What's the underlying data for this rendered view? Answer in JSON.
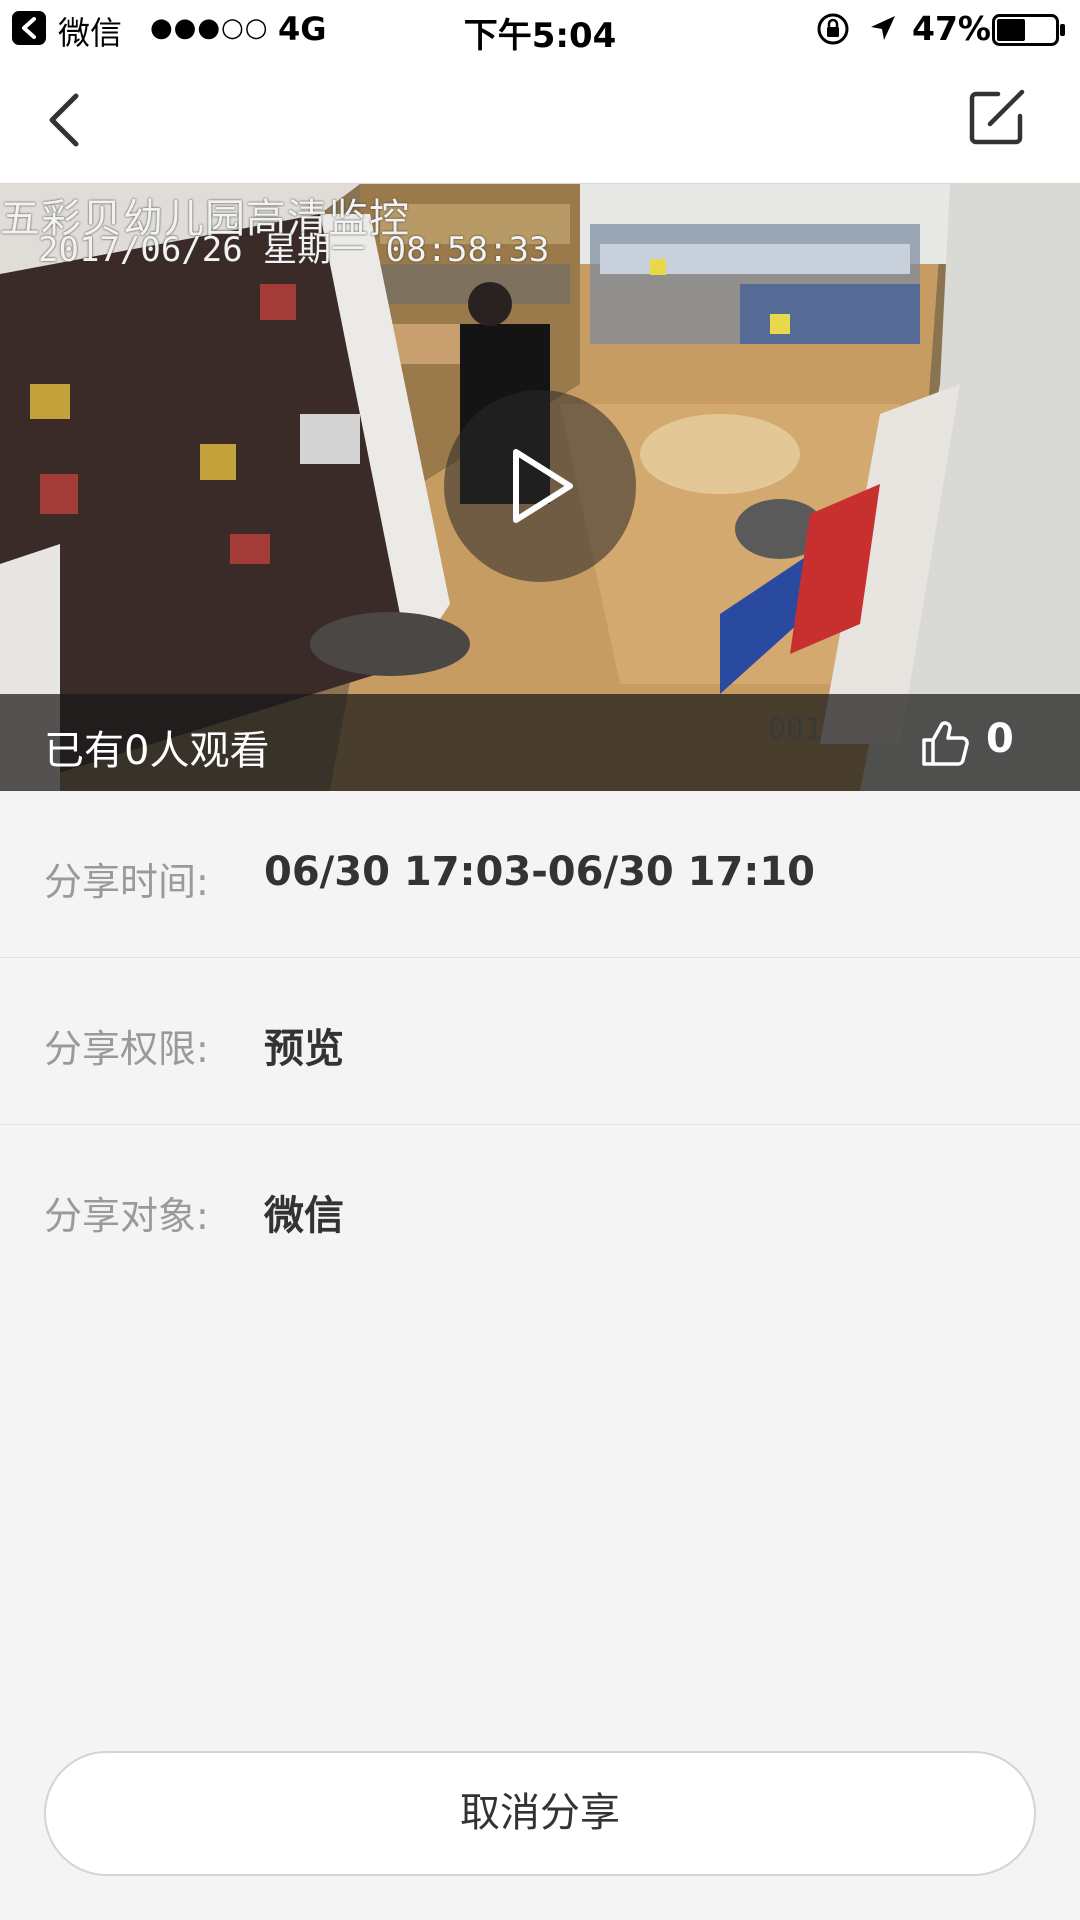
{
  "status_bar": {
    "app_name": "微信",
    "signal": "●●●○○",
    "network": "4G",
    "time": "下午5:04",
    "battery": "47%"
  },
  "nav": {
    "back_icon": "chevron-left-icon",
    "edit_icon": "edit-icon"
  },
  "video": {
    "osd_title": "五彩贝幼儿园高清监控",
    "osd_timestamp": "2017/06/26 星期一 08:58:33",
    "channel": "001",
    "viewer_text": "已有0人观看",
    "like_count": "0"
  },
  "details": {
    "time_label": "分享时间:",
    "time_value": "06/30 17:03-06/30 17:10",
    "permission_label": "分享权限:",
    "permission_value": "预览",
    "target_label": "分享对象:",
    "target_value": "微信"
  },
  "actions": {
    "cancel_share": "取消分享"
  },
  "colors": {
    "background": "#f4f4f4",
    "label": "#9a9a9a",
    "value": "#333333"
  }
}
